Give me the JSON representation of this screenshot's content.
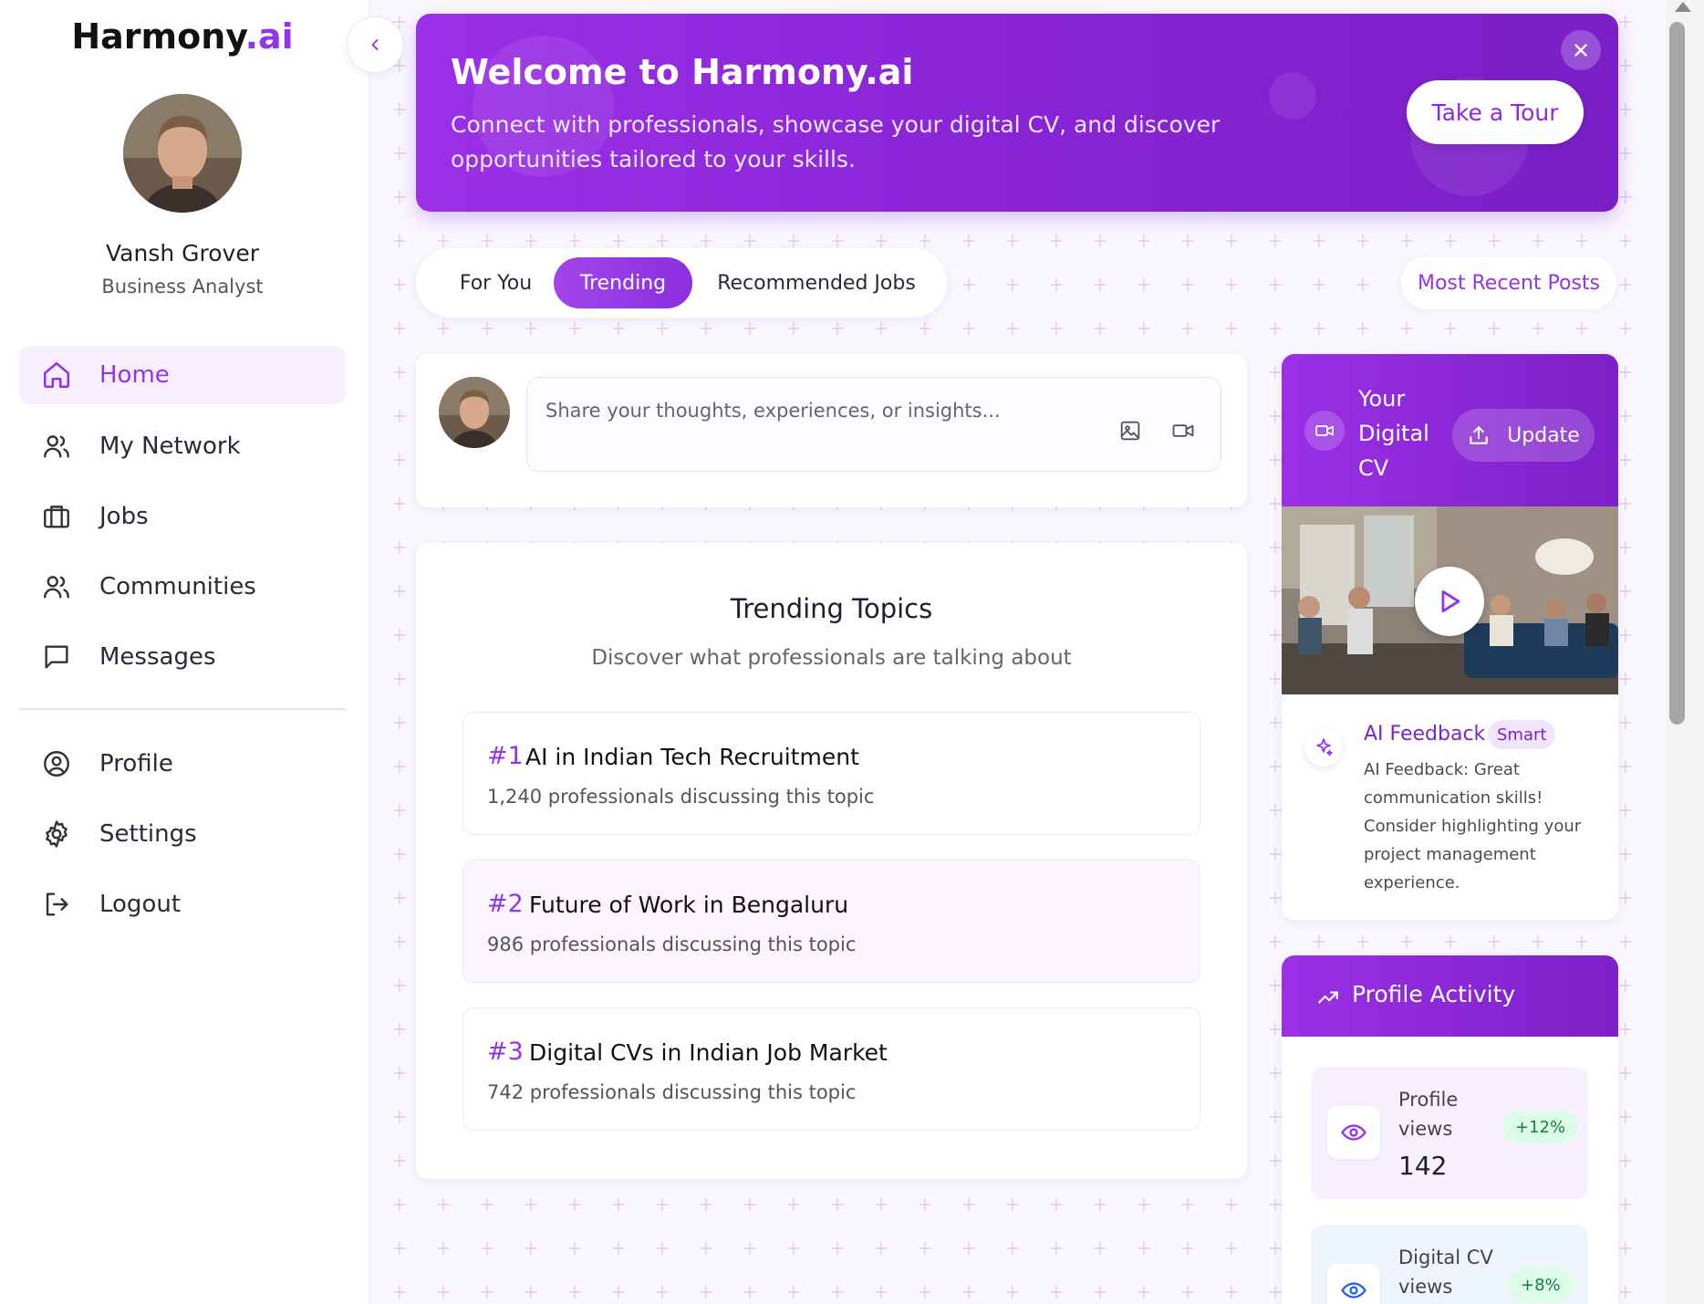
{
  "brand": {
    "name": "Harmony",
    "suffix": ".ai"
  },
  "user": {
    "name": "Vansh Grover",
    "role": "Business Analyst"
  },
  "nav": {
    "primary": [
      {
        "label": "Home",
        "icon": "home-icon",
        "active": true
      },
      {
        "label": "My Network",
        "icon": "users-icon"
      },
      {
        "label": "Jobs",
        "icon": "briefcase-icon"
      },
      {
        "label": "Communities",
        "icon": "users-icon"
      },
      {
        "label": "Messages",
        "icon": "message-icon"
      }
    ],
    "secondary": [
      {
        "label": "Profile",
        "icon": "user-circle-icon"
      },
      {
        "label": "Settings",
        "icon": "gear-icon"
      },
      {
        "label": "Logout",
        "icon": "logout-icon"
      }
    ]
  },
  "banner": {
    "title": "Welcome to Harmony.ai",
    "text": "Connect with professionals, showcase your digital CV, and discover opportunities tailored to your skills.",
    "cta": "Take a Tour"
  },
  "tabs": [
    {
      "label": "For You"
    },
    {
      "label": "Trending",
      "active": true
    },
    {
      "label": "Recommended Jobs"
    }
  ],
  "sort_button": "Most Recent Posts",
  "composer": {
    "placeholder": "Share your thoughts, experiences, or insights..."
  },
  "trending": {
    "title": "Trending Topics",
    "subtitle": "Discover what professionals are talking about",
    "topics": [
      {
        "rank": "#1",
        "name": "AI in Indian Tech Recruitment",
        "count": "1,240 professionals discussing this topic"
      },
      {
        "rank": "#2",
        "name": "Future of Work in Bengaluru",
        "count": "986 professionals discussing this topic"
      },
      {
        "rank": "#3",
        "name": "Digital CVs in Indian Job Market",
        "count": "742 professionals discussing this topic"
      }
    ]
  },
  "digital_cv": {
    "title": "Your Digital CV",
    "update_label": "Update",
    "feedback_title": "AI Feedback",
    "feedback_badge": "Smart",
    "feedback_text": "AI Feedback: Great communication skills! Consider highlighting your project management experience."
  },
  "activity": {
    "title": "Profile Activity",
    "stats": [
      {
        "label": "Profile views",
        "value": "142",
        "change": "+12%"
      },
      {
        "label": "Digital CV views",
        "value": "",
        "change": "+8%"
      }
    ]
  },
  "colors": {
    "accent": "#9333ea",
    "accent_dark": "#7c20c8",
    "positive": "#15803d"
  }
}
